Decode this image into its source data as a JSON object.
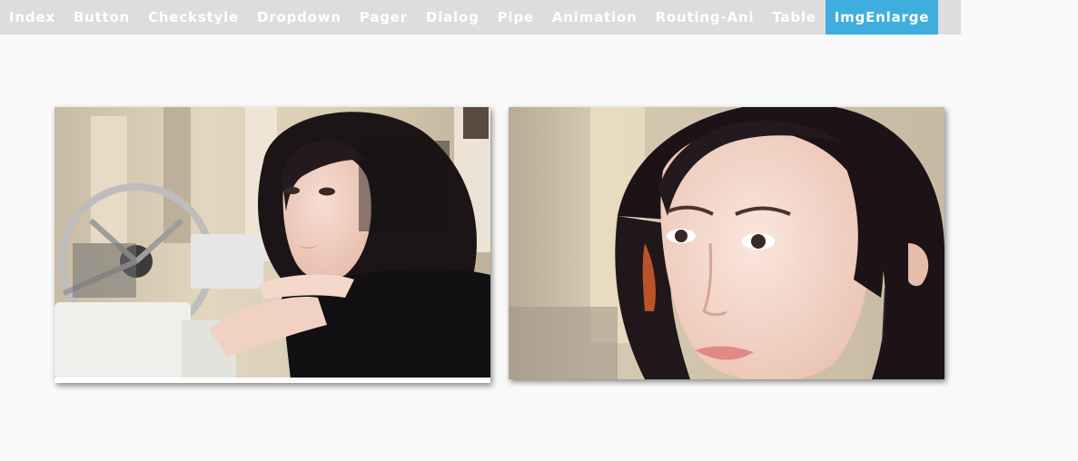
{
  "nav": {
    "items": [
      {
        "label": "Index"
      },
      {
        "label": "Button"
      },
      {
        "label": "Checkstyle"
      },
      {
        "label": "Dropdown"
      },
      {
        "label": "Pager"
      },
      {
        "label": "Dialog"
      },
      {
        "label": "Pipe"
      },
      {
        "label": "Animation"
      },
      {
        "label": "Routing-Ani"
      },
      {
        "label": "Table"
      },
      {
        "label": "ImgEnlarge"
      }
    ],
    "active_index": 10
  },
  "colors": {
    "nav_bg": "#dddddd",
    "nav_active": "#3eaede",
    "page_bg": "#f9f9f9"
  }
}
